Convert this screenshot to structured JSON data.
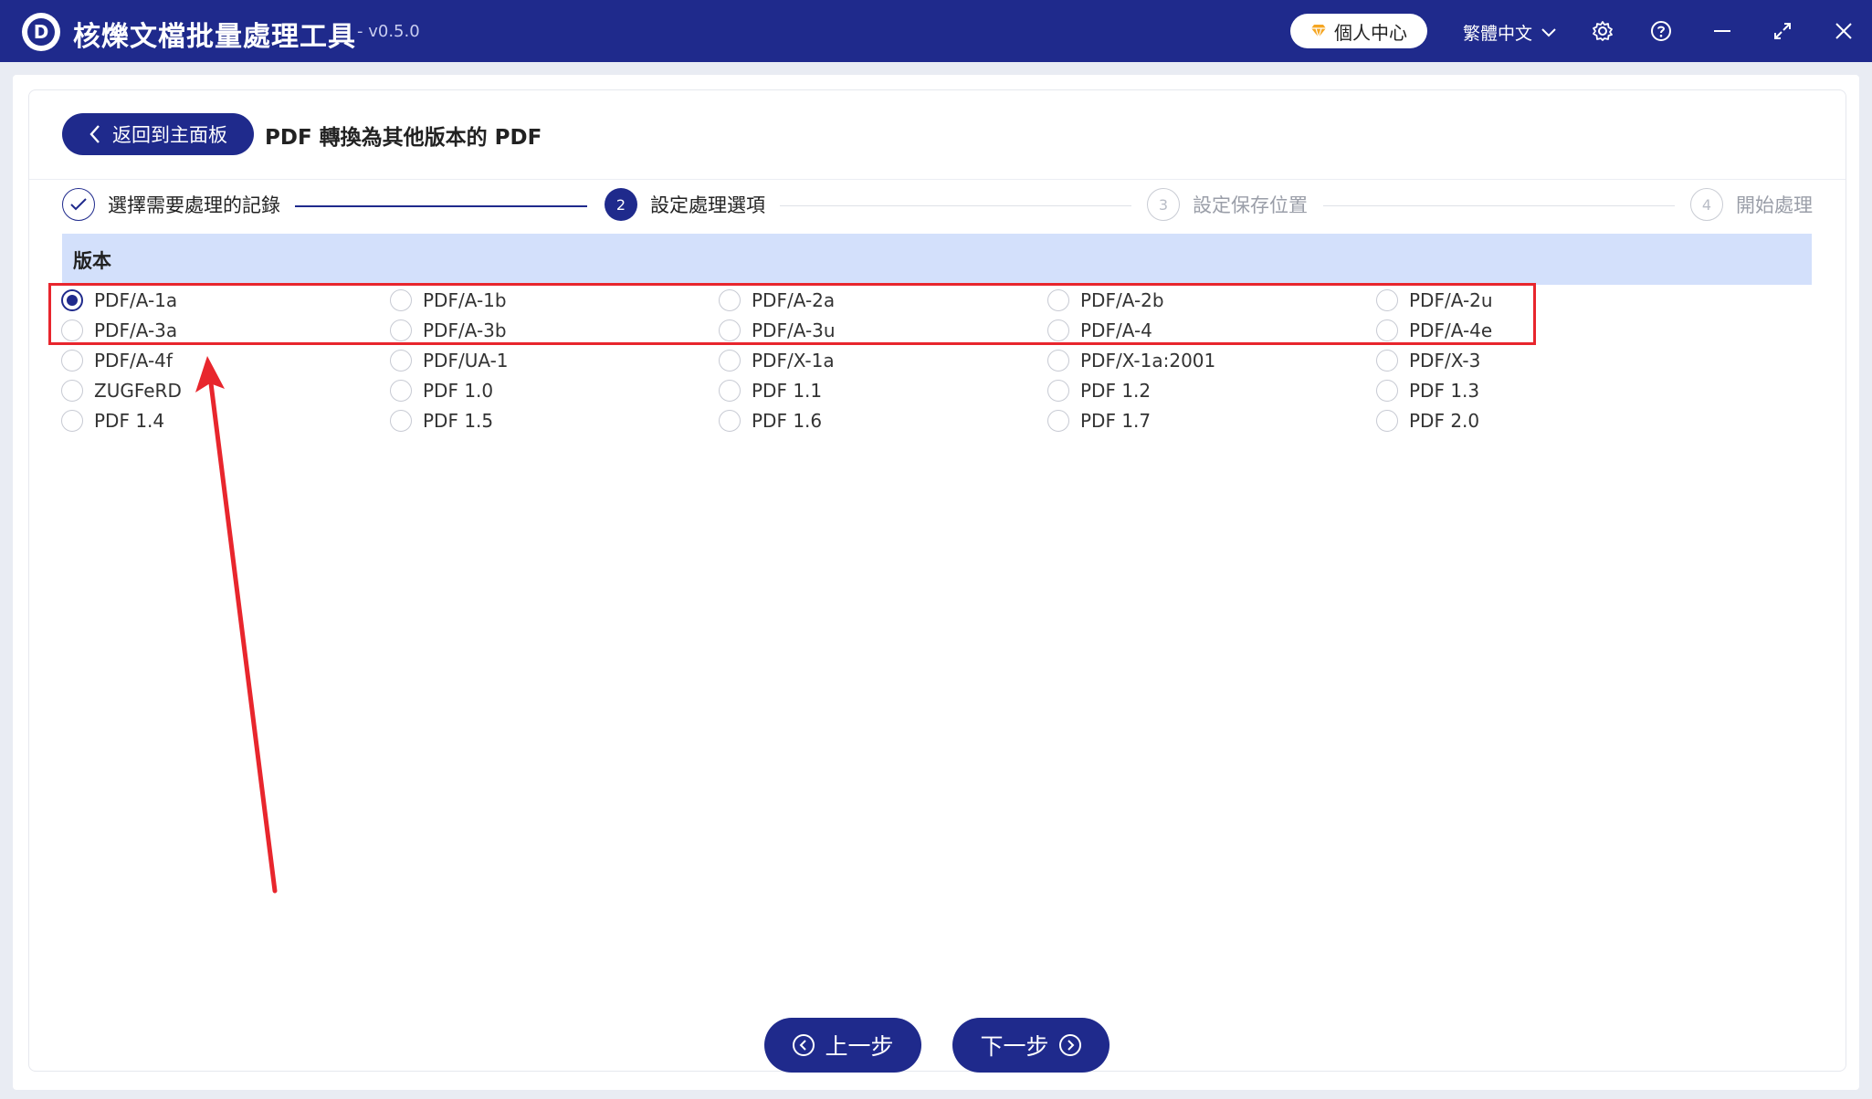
{
  "titlebar": {
    "app_title": "核爍文檔批量處理工具",
    "version": "- v0.5.0",
    "profile_label": "個人中心",
    "language_label": "繁體中文",
    "logo_letter": "D"
  },
  "header": {
    "back_label": "返回到主面板",
    "page_title": "PDF 轉換為其他版本的 PDF"
  },
  "steps": [
    {
      "label": "選擇需要處理的記錄",
      "state": "done"
    },
    {
      "label": "設定處理選項",
      "number": "2",
      "state": "active"
    },
    {
      "label": "設定保存位置",
      "number": "3",
      "state": "pending"
    },
    {
      "label": "開始處理",
      "number": "4",
      "state": "pending"
    }
  ],
  "section": {
    "title": "版本"
  },
  "options": [
    [
      "PDF/A-1a",
      "PDF/A-1b",
      "PDF/A-2a",
      "PDF/A-2b",
      "PDF/A-2u"
    ],
    [
      "PDF/A-3a",
      "PDF/A-3b",
      "PDF/A-3u",
      "PDF/A-4",
      "PDF/A-4e"
    ],
    [
      "PDF/A-4f",
      "PDF/UA-1",
      "PDF/X-1a",
      "PDF/X-1a:2001",
      "PDF/X-3"
    ],
    [
      "ZUGFeRD",
      "PDF 1.0",
      "PDF 1.1",
      "PDF 1.2",
      "PDF 1.3"
    ],
    [
      "PDF 1.4",
      "PDF 1.5",
      "PDF 1.6",
      "PDF 1.7",
      "PDF 2.0"
    ]
  ],
  "selected_option": "PDF/A-1a",
  "footer": {
    "prev_label": "上一步",
    "next_label": "下一步"
  },
  "colors": {
    "primary": "#1f2a8c",
    "section_bg": "#d3e0fb",
    "annotation_red": "#e8262d",
    "pending_gray": "#b8bcc6"
  }
}
